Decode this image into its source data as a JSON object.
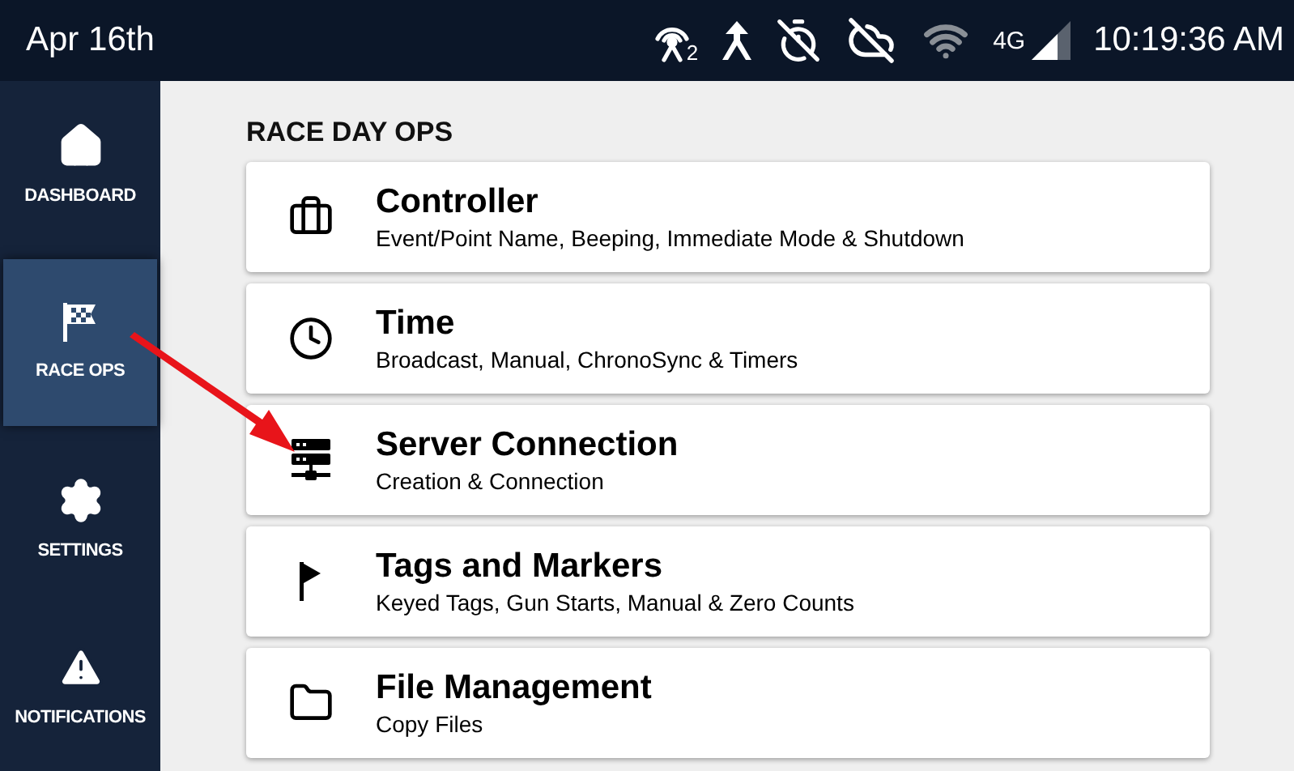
{
  "status_bar": {
    "date": "Apr 16th",
    "antenna_count": "2",
    "network": "4G",
    "time": "10:19:36 AM"
  },
  "sidebar": {
    "items": [
      {
        "kind": "home",
        "label": "DASHBOARD",
        "selected": false
      },
      {
        "kind": "flag",
        "label": "RACE OPS",
        "selected": true
      },
      {
        "kind": "gear",
        "label": "SETTINGS",
        "selected": false
      },
      {
        "kind": "alert",
        "label": "NOTIFICATIONS",
        "selected": false
      }
    ]
  },
  "main": {
    "heading": "RACE DAY OPS",
    "cards": [
      {
        "kind": "briefcase",
        "title": "Controller",
        "subtitle": "Event/Point Name, Beeping, Immediate Mode & Shutdown"
      },
      {
        "kind": "clock",
        "title": "Time",
        "subtitle": "Broadcast, Manual, ChronoSync & Timers"
      },
      {
        "kind": "server",
        "title": "Server Connection",
        "subtitle": "Creation & Connection"
      },
      {
        "kind": "marker",
        "title": "Tags and Markers",
        "subtitle": "Keyed Tags, Gun Starts, Manual & Zero Counts"
      },
      {
        "kind": "folder",
        "title": "File Management",
        "subtitle": "Copy Files"
      }
    ]
  }
}
